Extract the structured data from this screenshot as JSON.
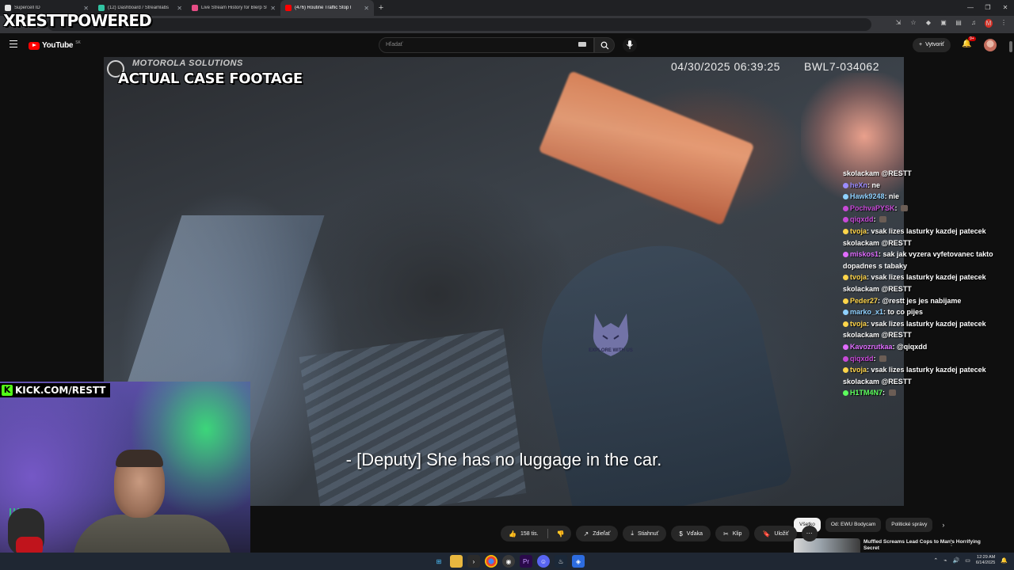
{
  "browser": {
    "tabs": [
      {
        "title": "Supercell ID",
        "favicon_color": "#e5e5e5",
        "active": false
      },
      {
        "title": "(12) Dashboard / Streamlabs",
        "favicon_color": "#31c3a2",
        "active": false
      },
      {
        "title": "Live Stream History for Blerp St",
        "favicon_color": "#e54d85",
        "active": false
      },
      {
        "title": "(476) Routine Traffic Stop I",
        "favicon_color": "#ff0000",
        "active": true
      }
    ],
    "url_fragment": "23bOj4",
    "profile_letter": "M"
  },
  "overlay": {
    "brand": "RESTTPOWERED",
    "brand_prefix": "X",
    "kick_label": "KICK.COM/RESTT",
    "kick_icon": "K"
  },
  "youtube": {
    "logo_text": "YouTube",
    "region": "SK",
    "search_placeholder": "Hľadať",
    "create_label": "Vytvoriť",
    "notifications": "9+"
  },
  "video": {
    "brand": "MOTOROLA SOLUTIONS",
    "label": "ACTUAL CASE FOOTAGE",
    "timestamp": "04/30/2025 06:39:25",
    "device_id": "BWL7-034062",
    "subtitle": "- [Deputy] She has no luggage in the car.",
    "watermark": "EXPLORE WITH US"
  },
  "chat": [
    {
      "user": "",
      "color": "#ffffff",
      "text": "skolackam @RESTT"
    },
    {
      "user": "heXn",
      "color": "#9b8cff",
      "text": "ne"
    },
    {
      "user": "Hawk9248",
      "color": "#8fd1ff",
      "text": "nie"
    },
    {
      "user": "PochvaPYSK",
      "color": "#c84ad8",
      "text": ""
    },
    {
      "user": "qiqxdd",
      "color": "#c84ad8",
      "text": ""
    },
    {
      "user": "tvoja",
      "color": "#ffd54a",
      "text": "vsak lizes lasturky kazdej patecek skolackam @RESTT"
    },
    {
      "user": "miskos1",
      "color": "#e06cff",
      "text": "sak jak vyzera vyfetovanec takto dopadnes s tabaky"
    },
    {
      "user": "tvoja",
      "color": "#ffd54a",
      "text": "vsak lizes lasturky kazdej patecek skolackam @RESTT"
    },
    {
      "user": "Peder27",
      "color": "#ffd54a",
      "text": "@restt jes jes nabijame"
    },
    {
      "user": "marko_x1",
      "color": "#8fd1ff",
      "text": "to co pijes"
    },
    {
      "user": "tvoja",
      "color": "#ffd54a",
      "text": "vsak lizes lasturky kazdej patecek skolackam @RESTT"
    },
    {
      "user": "Kavozrutkaa",
      "color": "#e06cff",
      "text": "@qiqxdd"
    },
    {
      "user": "qiqxdd",
      "color": "#c84ad8",
      "text": ""
    },
    {
      "user": "tvoja",
      "color": "#ffd54a",
      "text": "vsak lizes lasturky kazdej patecek skolackam @RESTT"
    },
    {
      "user": "H1TM4N7",
      "color": "#5dff5d",
      "text": ""
    }
  ],
  "actions": {
    "likes": "158 tis.",
    "share": "Zdieľať",
    "download": "Stiahnuť",
    "thanks": "Vďaka",
    "clip": "Klip",
    "save": "Uložiť"
  },
  "chips": [
    "Všetko",
    "Od: EWU Bodycam",
    "Politické správy"
  ],
  "related": {
    "title": "Muffled Screams Lead Cops to Man's Horrifying Secret"
  },
  "taskbar": {
    "time": "12:29 AM",
    "date": "6/14/2025"
  }
}
